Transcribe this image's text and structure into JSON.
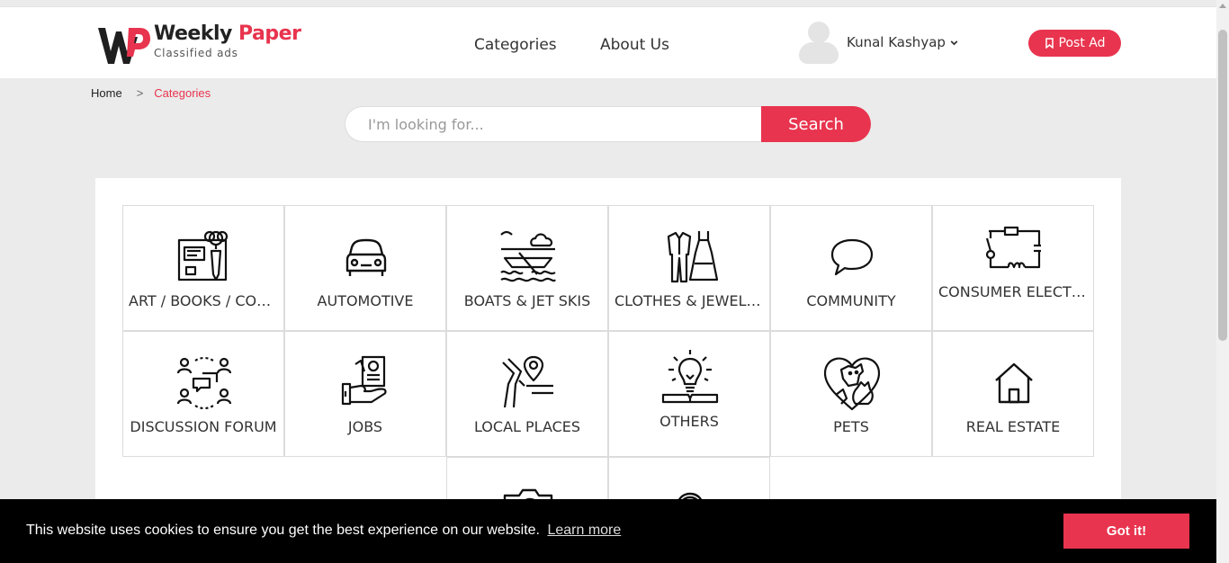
{
  "header": {
    "logo_title_1": "Weekly",
    "logo_title_2": "Paper",
    "logo_subtitle": "Classified ads",
    "nav": [
      "Categories",
      "About Us"
    ],
    "user_name": "Kunal Kashyap",
    "post_ad_label": "Post Ad"
  },
  "breadcrumb": {
    "home": "Home",
    "separator": ">",
    "current": "Categories"
  },
  "search": {
    "placeholder": "I'm looking for...",
    "value": "",
    "button_label": "Search"
  },
  "categories": [
    {
      "label": "ART / BOOKS / COLLECTIBLES",
      "icon": "art-books-icon"
    },
    {
      "label": "AUTOMOTIVE",
      "icon": "car-icon"
    },
    {
      "label": "BOATS & JET SKIS",
      "icon": "boat-icon"
    },
    {
      "label": "CLOTHES & JEWELRY",
      "icon": "clothes-icon"
    },
    {
      "label": "COMMUNITY",
      "icon": "speech-bubble-icon"
    },
    {
      "label": "CONSUMER ELECTRONICS",
      "icon": "circuit-icon"
    },
    {
      "label": "DISCUSSION FORUM",
      "icon": "discussion-icon"
    },
    {
      "label": "JOBS",
      "icon": "job-card-icon"
    },
    {
      "label": "LOCAL PLACES",
      "icon": "location-pin-icon"
    },
    {
      "label": "OTHERS",
      "icon": "lightbulb-book-icon"
    },
    {
      "label": "PETS",
      "icon": "pets-heart-icon"
    },
    {
      "label": "REAL ESTATE",
      "icon": "house-icon"
    },
    {
      "label": "",
      "icon": "camera-icon"
    },
    {
      "label": "",
      "icon": "helmet-icon"
    }
  ],
  "cookie": {
    "message": "This website uses cookies to ensure you get the best experience on our website.",
    "link": "Learn more",
    "button": "Got it!"
  },
  "colors": {
    "accent": "#e8344e",
    "background": "#ebebeb",
    "cookie_bar": "#000000"
  }
}
